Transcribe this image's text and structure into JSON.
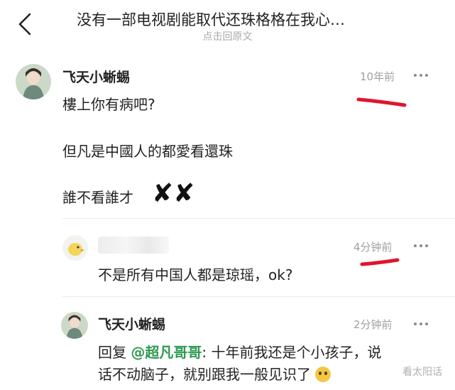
{
  "header": {
    "title": "没有一部电视剧能取代还珠格格在我心…",
    "subtitle": "点击回原文"
  },
  "comments": [
    {
      "name": "飞天小蜥蜴",
      "time": "10年前",
      "lines": [
        "樓上你有病吧?",
        "但凡是中國人的都愛看還珠",
        "誰不看誰才"
      ],
      "mark": "✘✘"
    },
    {
      "name": "",
      "time": "4分钟前",
      "text": "不是所有中国人都是琼瑶，ok?"
    },
    {
      "name": "飞天小蜥蜴",
      "time": "2分钟前",
      "reply_prefix": "回复 ",
      "reply_target": "@超凡哥哥",
      "reply_line1": ": 十年前我还是个小孩子，说",
      "reply_line2": "话不动脑子，就别跟我一般见识了"
    }
  ],
  "watermark": "看太阳话",
  "colors": {
    "accent_green": "#2e9a52",
    "annotation_red": "#e0152d"
  },
  "icons": {
    "back": "chevron-left-icon",
    "more": "more-dots-icon"
  }
}
